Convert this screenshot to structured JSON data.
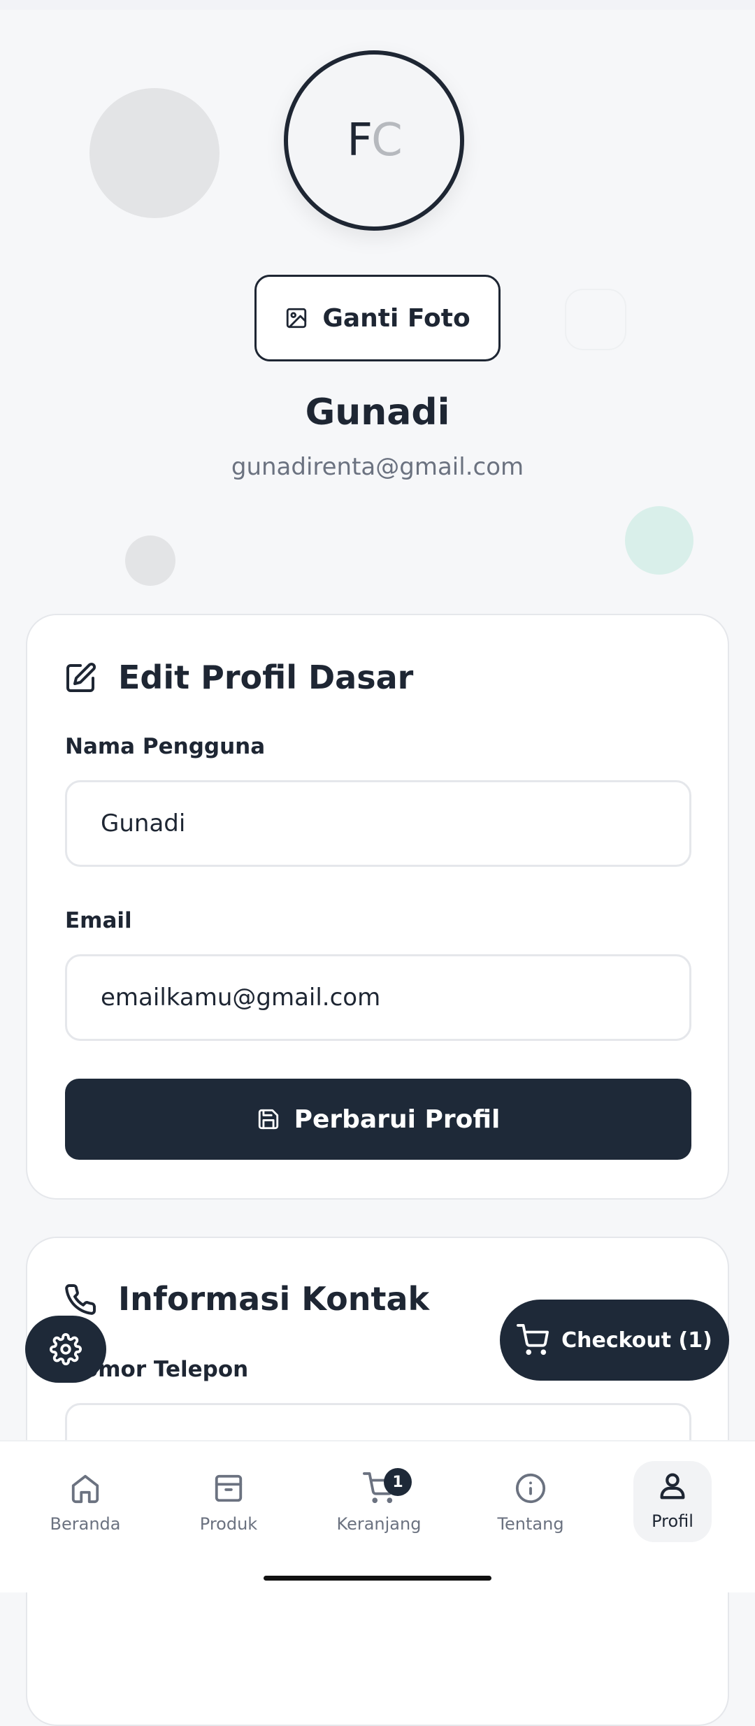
{
  "profile": {
    "avatar_initial_1": "F",
    "avatar_initial_2": "C",
    "change_photo_label": "Ganti Foto",
    "name": "Gunadi",
    "email": "gunadirenta@gmail.com"
  },
  "basic_card": {
    "title": "Edit Profil Dasar",
    "username_label": "Nama Pengguna",
    "username_value": "Gunadi",
    "email_label": "Email",
    "email_value": "emailkamu@gmail.com",
    "submit_label": "Perbarui Profil"
  },
  "contact_card": {
    "title": "Informasi Kontak",
    "phone_label": "Nomor Telepon"
  },
  "floating": {
    "checkout_label": "Checkout (1)"
  },
  "nav": {
    "items": [
      {
        "label": "Beranda",
        "icon": "home-icon"
      },
      {
        "label": "Produk",
        "icon": "box-icon"
      },
      {
        "label": "Keranjang",
        "icon": "cart-icon",
        "badge": "1"
      },
      {
        "label": "Tentang",
        "icon": "info-icon"
      },
      {
        "label": "Profil",
        "icon": "user-icon",
        "active": true
      }
    ]
  },
  "colors": {
    "primary_dark": "#1e2938",
    "muted_text": "#6b7280",
    "background": "#f6f7f9"
  }
}
